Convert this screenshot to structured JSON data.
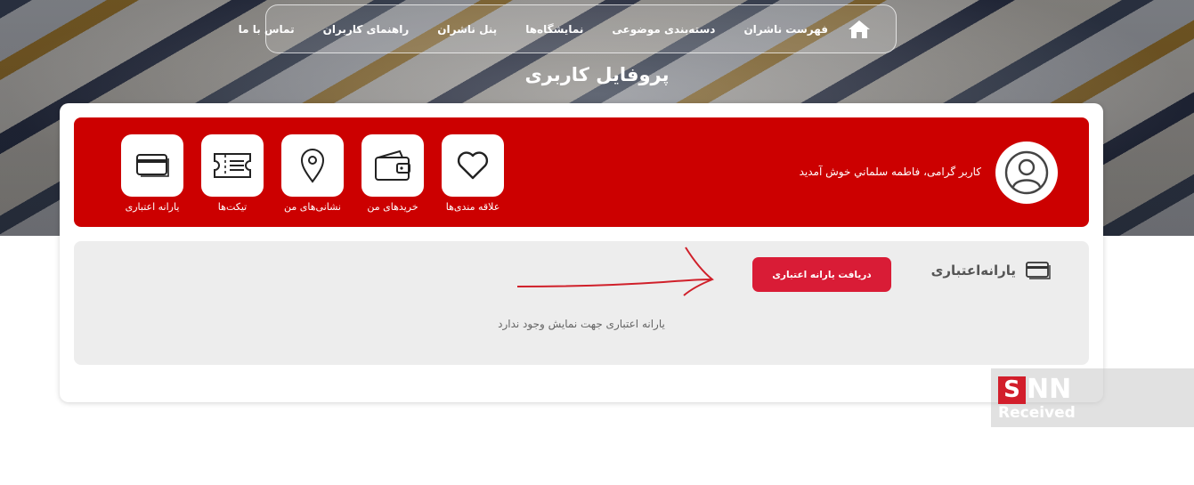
{
  "nav": {
    "items": [
      {
        "label": "فهرست ناشران"
      },
      {
        "label": "دسته‌بندی موضوعی"
      },
      {
        "label": "نمایشگاه‌ها"
      },
      {
        "label": "پنل ناشران"
      },
      {
        "label": "راهنمای کاربران"
      },
      {
        "label": "تماس با ما"
      }
    ],
    "home_icon": "home-icon"
  },
  "page_title": "پروفایل کاربری",
  "profile": {
    "welcome": "کاربر گرامی، فاطمه سلماني خوش آمدید",
    "avatar_icon": "user-icon"
  },
  "tiles": [
    {
      "label": "یارانه اعتباری",
      "icon": "credit-card-icon"
    },
    {
      "label": "تیکت‌ها",
      "icon": "ticket-icon"
    },
    {
      "label": "نشانی‌های من",
      "icon": "location-pin-icon"
    },
    {
      "label": "خریدهای من",
      "icon": "wallet-icon"
    },
    {
      "label": "علاقه مندی‌ها",
      "icon": "heart-icon"
    }
  ],
  "section": {
    "title": "یارانه‌اعتباری",
    "button_label": "دریافت یارانه اعتباری",
    "empty_message": "یارانه اعتباری جهت نمایش وجود ندارد"
  },
  "watermark": {
    "letter": "S",
    "rest": "NN",
    "caption": "Received"
  },
  "colors": {
    "brand_red": "#cc0000",
    "button_red": "#d91c36",
    "annotation_arrow": "#d0202a"
  }
}
